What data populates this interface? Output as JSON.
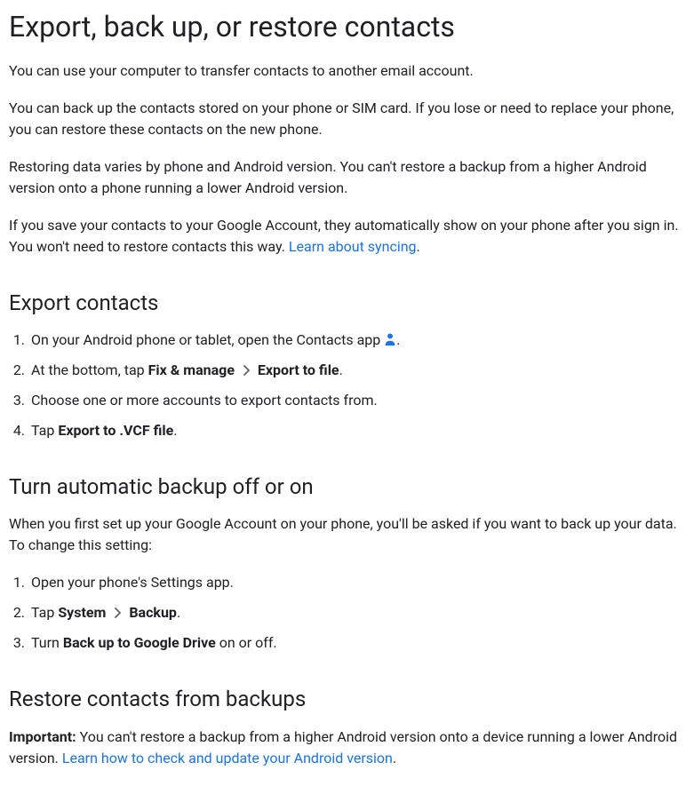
{
  "title": "Export, back up, or restore contacts",
  "intro": {
    "p1": "You can use your computer to transfer contacts to another email account.",
    "p2": "You can back up the contacts stored on your phone or SIM card. If you lose or need to replace your phone, you can restore these contacts on the new phone.",
    "p3": "Restoring data varies by phone and Android version. You can't restore a backup from a higher Android version onto a phone running a lower Android version.",
    "p4a": "If you save your contacts to your Google Account, they automatically show on your phone after you sign in. You won't need to restore contacts this way. ",
    "p4_link": "Learn about syncing",
    "p4b": "."
  },
  "export": {
    "heading": "Export contacts",
    "step1a": "On your Android phone or tablet, open the Contacts app ",
    "step1b": ".",
    "step2a": "At the bottom, tap ",
    "step2b": "Fix & manage",
    "step2c": "Export to file",
    "step2d": ".",
    "step3": "Choose one or more accounts to export contacts from.",
    "step4a": "Tap ",
    "step4b": "Export to .VCF file",
    "step4c": "."
  },
  "backup": {
    "heading": "Turn automatic backup off or on",
    "intro": "When you first set up your Google Account on your phone, you'll be asked if you want to back up your data. To change this setting:",
    "step1": "Open your phone's Settings app.",
    "step2a": "Tap ",
    "step2b": "System",
    "step2c": "Backup",
    "step2d": ".",
    "step3a": "Turn ",
    "step3b": "Back up to Google Drive",
    "step3c": " on or off."
  },
  "restore": {
    "heading": "Restore contacts from backups",
    "important_label": "Important:",
    "important_text": " You can't restore a backup from a higher Android version onto a device running a lower Android version. ",
    "important_link": "Learn how to check and update your Android version",
    "important_end": "."
  }
}
